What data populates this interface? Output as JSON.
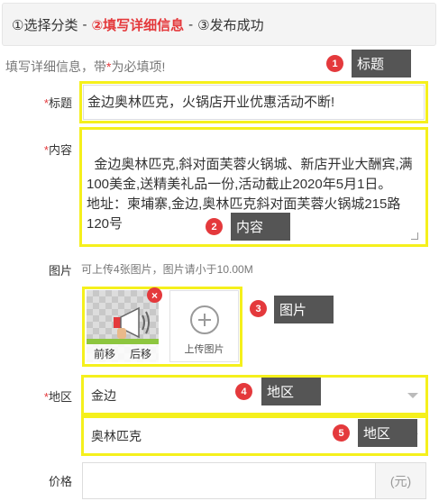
{
  "steps": {
    "step1": "①选择分类",
    "sep1": "-",
    "step2": "②填写详细信息",
    "sep2": "-",
    "step3": "③发布成功"
  },
  "hint": {
    "prefix": "填写详细信息，带",
    "star": "*",
    "suffix": "为必填项!"
  },
  "form": {
    "title_label": "标题",
    "title_value": "金边奥林匹克，火锅店开业优惠活动不断!",
    "content_label": "内容",
    "content_value": "金边奥林匹克,斜对面芙蓉火锅城、新店开业大酬宾,满100美金,送精美礼品一份,活动截止2020年5月1日。\n地址：柬埔寨,金边,奥林匹克斜对面芙蓉火锅城215路120号",
    "pictures_label": "图片",
    "pictures_hint": "可上传4张图片，图片请小于10.00M",
    "thumb_move_prev": "前移",
    "thumb_move_next": "后移",
    "delete_symbol": "×",
    "upload_label": "上传图片",
    "region_label": "地区",
    "region_city": "金边",
    "region_area": "奥林匹克",
    "price_label": "价格",
    "price_unit": "(元)",
    "required_mark": "*"
  },
  "annotations": [
    {
      "num": "1",
      "label": "标题"
    },
    {
      "num": "2",
      "label": "内容"
    },
    {
      "num": "3",
      "label": "图片"
    },
    {
      "num": "4",
      "label": "地区"
    },
    {
      "num": "5",
      "label": "地区"
    }
  ],
  "colors": {
    "accent_red": "#e4393c",
    "highlight_yellow": "#f5f01c",
    "tag_gray": "#555555"
  }
}
